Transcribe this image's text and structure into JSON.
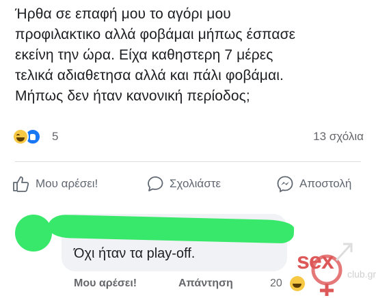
{
  "post": {
    "lines": [
      "Ήρθα σε επαφή μου το αγόρι μου",
      "προφιλακτικο αλλά φοβάμαι μήπως έσπασε",
      "εκείνη την ώρα. Είχα καθηστερη 7 μέρες",
      "τελικά αδιαθετησα αλλά και πάλι φοβάμαι.",
      "Μήπως δεν ήταν κανονική περίοδος;"
    ]
  },
  "reactions": {
    "count": "5",
    "icons": [
      "haha-icon",
      "like-icon"
    ],
    "comments": "13 σχόλια"
  },
  "actions": {
    "like": "Μου αρέσει!",
    "comment": "Σχολιάστε",
    "send": "Αποστολή"
  },
  "comment": {
    "text": "Όχι ήταν τα play-off.",
    "like": "Μου αρέσει!",
    "reply": "Απάντηση",
    "reaction_count": "20"
  },
  "watermark": {
    "logo": "sex",
    "suffix": "club.gr"
  },
  "colors": {
    "text": "#1c1e21",
    "muted": "#65676b",
    "like_blue": "#1877f2",
    "haha_yellow": "#f7c844",
    "scribble_green": "#38e86a",
    "watermark_red": "#d83b3b"
  }
}
